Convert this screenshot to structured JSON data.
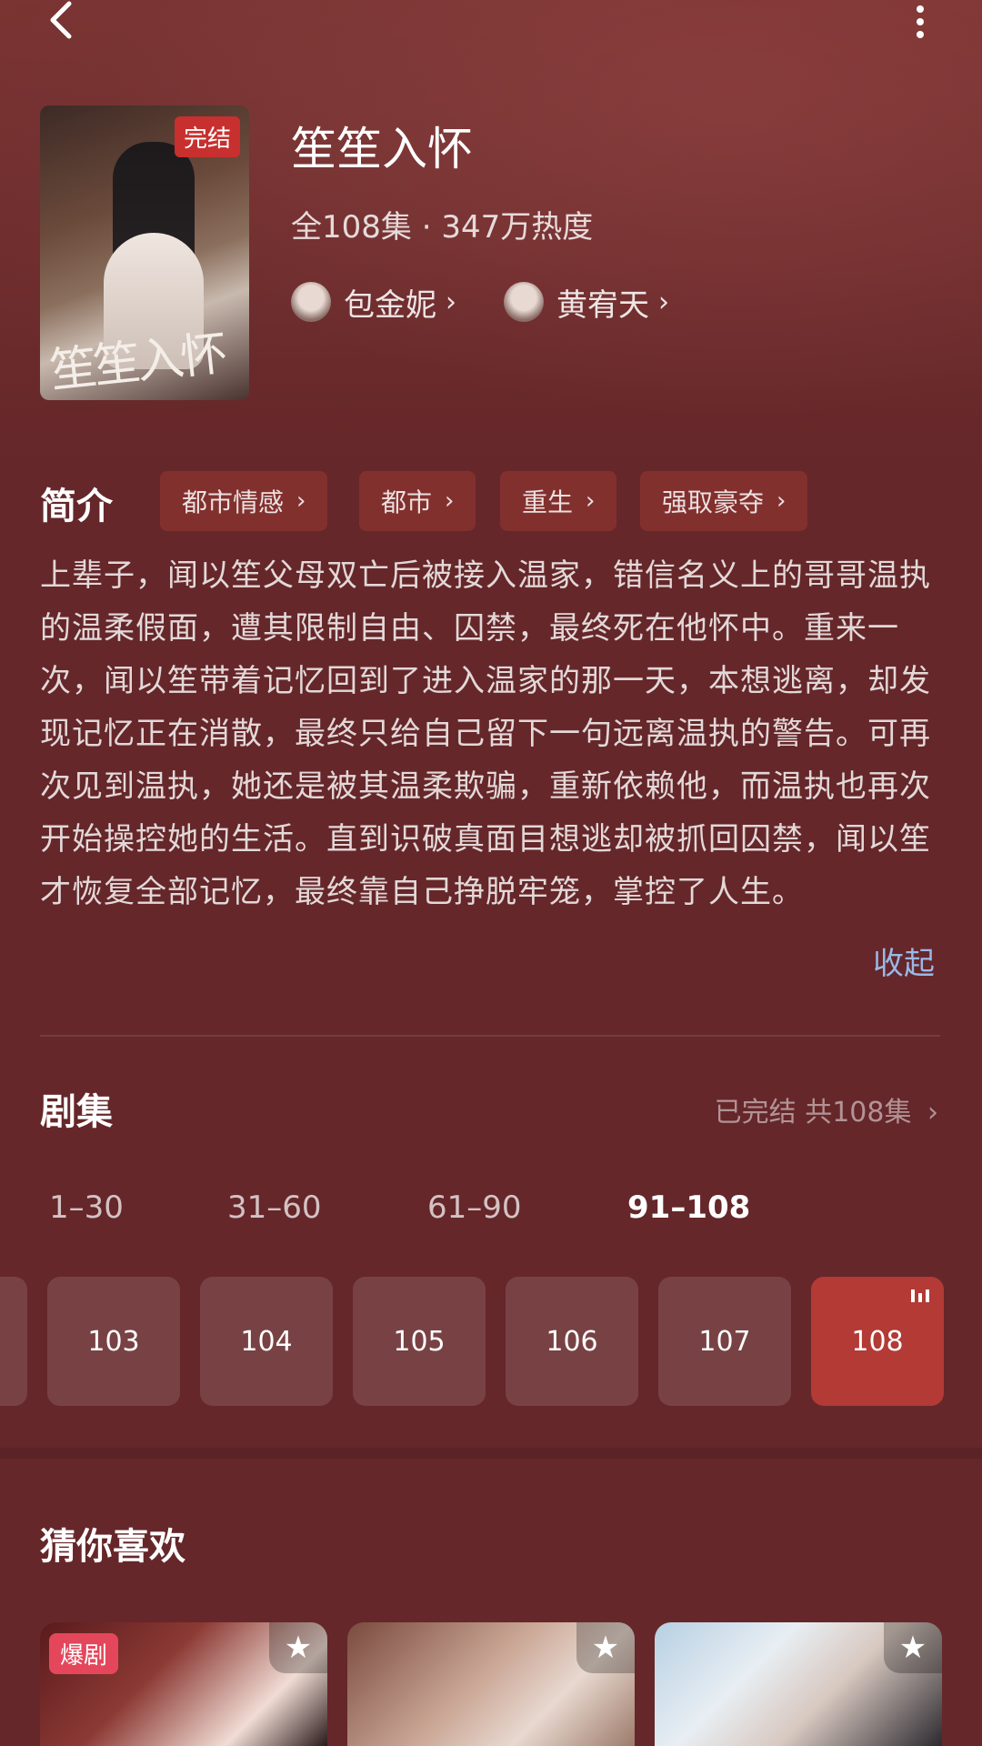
{
  "header": {
    "back_icon": "back-arrow-icon",
    "more_icon": "more-vertical-icon"
  },
  "drama": {
    "title": "笙笙入怀",
    "status_badge": "完结",
    "poster_calligraphy": "笙笙入怀",
    "meta": "全108集 · 347万热度",
    "actors": [
      {
        "name": "包金妮"
      },
      {
        "name": "黄宥天"
      }
    ]
  },
  "synopsis": {
    "heading": "简介",
    "tags": [
      "都市情感",
      "都市",
      "重生",
      "强取豪夺"
    ],
    "text": "上辈子，闻以笙父母双亡后被接入温家，错信名义上的哥哥温执的温柔假面，遭其限制自由、囚禁，最终死在他怀中。重来一次，闻以笙带着记忆回到了进入温家的那一天，本想逃离，却发现记忆正在消散，最终只给自己留下一句远离温执的警告。可再次见到温执，她还是被其温柔欺骗，重新依赖他，而温执也再次开始操控她的生活。直到识破真面目想逃却被抓回囚禁，闻以笙才恢复全部记忆，最终靠自己挣脱牢笼，掌控了人生。",
    "collapse_label": "收起"
  },
  "episodes": {
    "heading": "剧集",
    "status": "已完结 共108集",
    "ranges": [
      "1–30",
      "31–60",
      "61–90",
      "91–108"
    ],
    "active_range": "91–108",
    "items": [
      "103",
      "104",
      "105",
      "106",
      "107",
      "108"
    ],
    "current": "108"
  },
  "recommend": {
    "heading": "猜你喜欢",
    "cards": [
      {
        "badge": "爆剧"
      },
      {
        "badge": ""
      },
      {
        "badge": ""
      }
    ]
  },
  "colors": {
    "background": "#65272a",
    "tag_bg": "#82302e",
    "accent": "#b33a35",
    "link": "#9ab8e8",
    "badge": "#c7302e"
  }
}
